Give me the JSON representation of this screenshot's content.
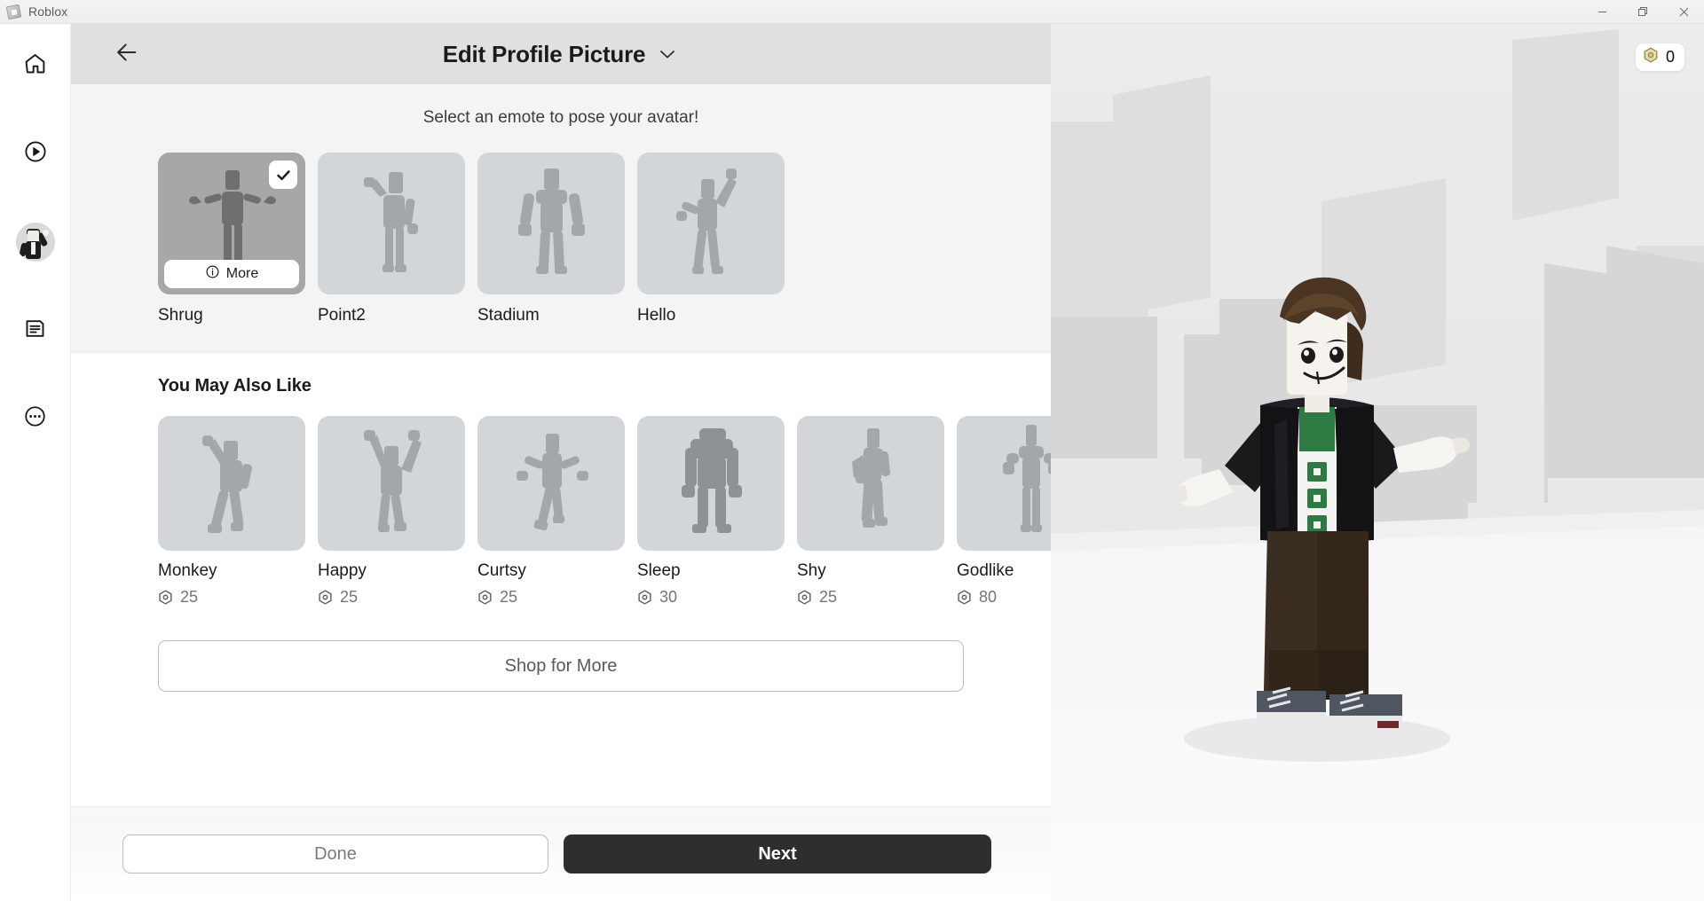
{
  "window": {
    "app_title": "Roblox",
    "logo_icon": "roblox-logo-icon",
    "minimize_icon": "minimize-icon",
    "maximize_icon": "maximize-restore-icon",
    "close_icon": "close-icon"
  },
  "rail": {
    "items": [
      {
        "icon": "home-icon",
        "name": "home"
      },
      {
        "icon": "discover-play-icon",
        "name": "discover"
      },
      {
        "icon": "avatar-icon",
        "name": "avatar"
      },
      {
        "icon": "chat-icon",
        "name": "chat"
      },
      {
        "icon": "more-ellipsis-icon",
        "name": "more"
      }
    ]
  },
  "header": {
    "back_icon": "back-arrow-icon",
    "title": "Edit Profile Picture",
    "chevron_icon": "chevron-down-icon"
  },
  "emote_section": {
    "hint": "Select an emote to pose your avatar!",
    "more_label": "More",
    "info_icon": "info-icon",
    "check_icon": "check-icon",
    "cards": [
      {
        "name": "Shrug",
        "selected": true,
        "pose": "shrug"
      },
      {
        "name": "Point2",
        "selected": false,
        "pose": "point"
      },
      {
        "name": "Stadium",
        "selected": false,
        "pose": "stadium"
      },
      {
        "name": "Hello",
        "selected": false,
        "pose": "hello"
      }
    ]
  },
  "recommendations": {
    "title": "You May Also Like",
    "currency_icon": "robux-icon",
    "items": [
      {
        "name": "Monkey",
        "price": "25",
        "pose": "monkey"
      },
      {
        "name": "Happy",
        "price": "25",
        "pose": "happy"
      },
      {
        "name": "Curtsy",
        "price": "25",
        "pose": "curtsy"
      },
      {
        "name": "Sleep",
        "price": "30",
        "pose": "sleep"
      },
      {
        "name": "Shy",
        "price": "25",
        "pose": "shy"
      },
      {
        "name": "Godlike",
        "price": "80",
        "pose": "godlike"
      }
    ]
  },
  "shop": {
    "label": "Shop for More"
  },
  "footer": {
    "done_label": "Done",
    "next_label": "Next"
  },
  "viewport": {
    "balance_value": "0",
    "balance_icon": "robux-gold-icon",
    "avatar_pose": "shrug"
  },
  "colors": {
    "header_bg": "#e0e0e0",
    "emote_section_bg": "#f4f4f5",
    "card_bg": "#d3d6d8",
    "card_selected_bg": "#a7a7a7",
    "next_button_bg": "#2e2e2e",
    "robux_gold": "#b8a046",
    "text_primary": "#1b1b1b",
    "text_muted": "#757575"
  }
}
